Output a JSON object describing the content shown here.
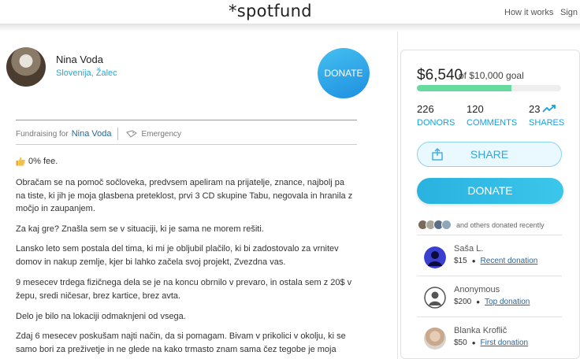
{
  "header": {
    "logo": "*spotfund",
    "nav": {
      "how": "How it works",
      "sign": "Sign in"
    }
  },
  "campaign": {
    "organizer_name": "Nina Voda",
    "location": "Slovenija, Žalec",
    "donate_circle": "DONATE",
    "fundraising_for_label": "Fundraising for",
    "fundraising_for_link": "Nina Voda",
    "category": "Emergency",
    "fee": "0% fee.",
    "paragraphs": [
      "Obračam se na pomoč sočloveka, predvsem apeliram na prijatelje, znance, najbolj pa na tiste, ki jih je moja glasbena preteklost, prvi 3 CD skupine Tabu, negovala in hranila z močjo in zaupanjem.",
      "Za kaj gre? Znašla sem se v situaciji, ki je sama ne morem rešiti.",
      "Lansko leto sem postala del tima, ki mi je obljubil plačilo, ki bi zadostovalo za vrnitev domov in nakup zemlje, kjer bi lahko začela svoj projekt, Zvezdna vas.",
      "9 mesecev trdega fizičnega dela se je na koncu obrnilo v prevaro, in ostala sem z 20$ v žepu, sredi ničesar, brez kartice, brez avta.",
      "Delo je bilo na lokaciji odmaknjeni od vsega.",
      "Zdaj 6 mesecev poskušam najti način, da si pomagam. Bivam v prikolici v okolju, ki se samo bori za preživetje in ne glede na kako trmasto znam sama čez tegobe je moja"
    ]
  },
  "sidebar": {
    "raised": "$6,540",
    "goal": "of $10,000 goal",
    "progress_fraction": 0.654,
    "stats": [
      {
        "num": "226",
        "label": "DONORS"
      },
      {
        "num": "120",
        "label": "COMMENTS"
      },
      {
        "num": "23",
        "label": "SHARES"
      }
    ],
    "share_label": "SHARE",
    "donate_label": "DONATE",
    "recent_text": "and others donated recently",
    "donors": [
      {
        "name": "Saša L.",
        "amount": "$15",
        "note": "Recent donation"
      },
      {
        "name": "Anonymous",
        "amount": "$200",
        "note": "Top donation"
      },
      {
        "name": "Blanka Kroflič",
        "amount": "$50",
        "note": "First donation"
      }
    ]
  },
  "colors": {
    "accent": "#2ab2e0",
    "progress": "#65dba0",
    "link": "#2a6496"
  }
}
